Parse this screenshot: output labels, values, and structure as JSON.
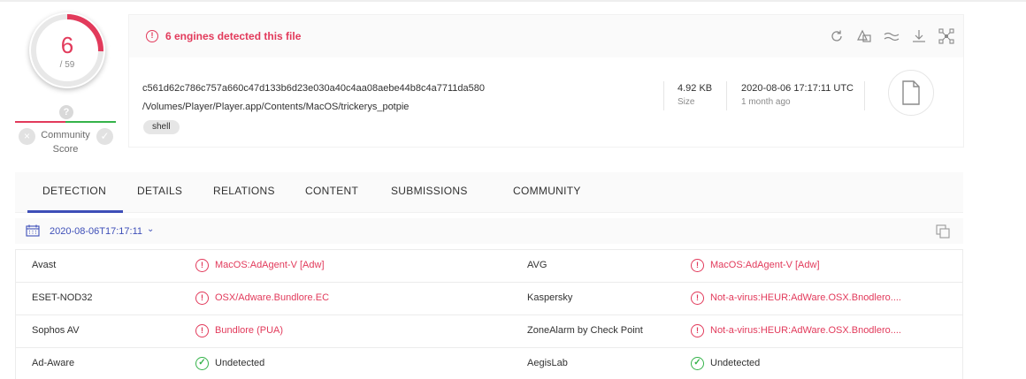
{
  "score": {
    "detected": "6",
    "total": "/ 59",
    "ratio": 0.1017
  },
  "community": {
    "label_line1": "Community",
    "label_line2": "Score",
    "q": "?",
    "down": "×",
    "up": "✓"
  },
  "alert": {
    "icon": "!",
    "text": "6 engines detected this file"
  },
  "toolbar": {
    "icons": [
      "reanalyze-icon",
      "similar-icon",
      "compare-icon",
      "download-icon",
      "graph-icon"
    ]
  },
  "file": {
    "hash": "c561d62c786c757a660c47d133b6d23e030a40c4aa08aebe44b8c4a7711da580",
    "path": "/Volumes/Player/Player.app/Contents/MacOS/trickerys_potpie",
    "tag": "shell",
    "size_value": "4.92 KB",
    "size_label": "Size",
    "date_value": "2020-08-06 17:17:11 UTC",
    "date_relative": "1 month ago",
    "type_icon": "file-icon"
  },
  "tabs": [
    "DETECTION",
    "DETAILS",
    "RELATIONS",
    "CONTENT",
    "SUBMISSIONS",
    "COMMUNITY"
  ],
  "scan": {
    "date": "2020-08-06T17:17:11",
    "chevron": "⌄"
  },
  "detections": [
    {
      "left": {
        "engine": "Avast",
        "result": "MacOS:AdAgent-V [Adw]",
        "status": "bad"
      },
      "right": {
        "engine": "AVG",
        "result": "MacOS:AdAgent-V [Adw]",
        "status": "bad"
      }
    },
    {
      "left": {
        "engine": "ESET-NOD32",
        "result": "OSX/Adware.Bundlore.EC",
        "status": "bad"
      },
      "right": {
        "engine": "Kaspersky",
        "result": "Not-a-virus:HEUR:AdWare.OSX.Bnodlero....",
        "status": "bad"
      }
    },
    {
      "left": {
        "engine": "Sophos AV",
        "result": "Bundlore (PUA)",
        "status": "bad"
      },
      "right": {
        "engine": "ZoneAlarm by Check Point",
        "result": "Not-a-virus:HEUR:AdWare.OSX.Bnodlero....",
        "status": "bad"
      }
    },
    {
      "left": {
        "engine": "Ad-Aware",
        "result": "Undetected",
        "status": "ok"
      },
      "right": {
        "engine": "AegisLab",
        "result": "Undetected",
        "status": "ok"
      }
    }
  ],
  "colors": {
    "malicious": "#e23a5b",
    "clean": "#35b34a",
    "accent": "#3e4fb8"
  }
}
